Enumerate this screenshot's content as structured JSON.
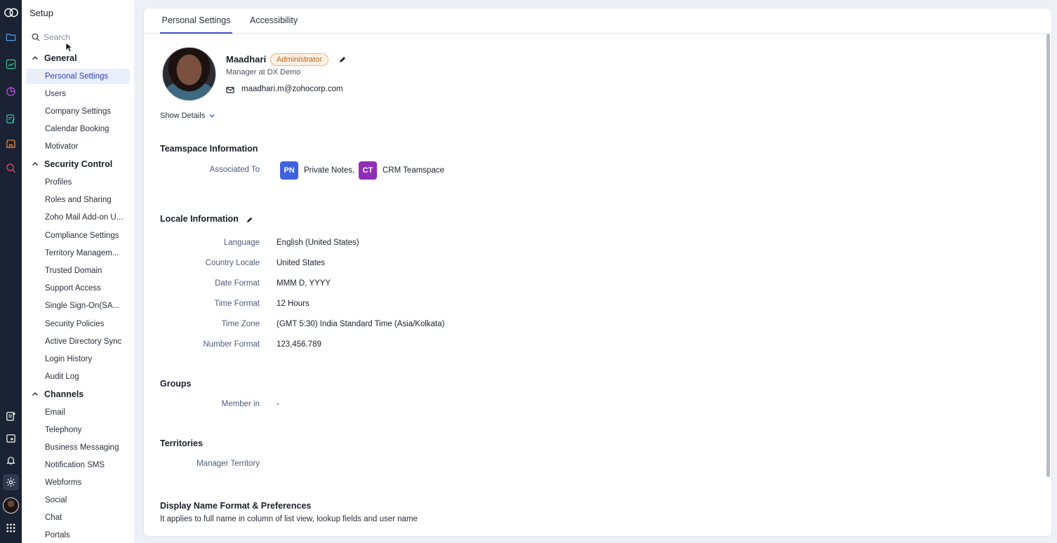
{
  "setup": {
    "title": "Setup",
    "search_placeholder": "Search",
    "groups": [
      {
        "label": "General",
        "items": [
          "Personal Settings",
          "Users",
          "Company Settings",
          "Calendar Booking",
          "Motivator"
        ]
      },
      {
        "label": "Security Control",
        "items": [
          "Profiles",
          "Roles and Sharing",
          "Zoho Mail Add-on U...",
          "Compliance Settings",
          "Territory Managem...",
          "Trusted Domain",
          "Support Access",
          "Single Sign-On(SA...",
          "Security Policies",
          "Active Directory Sync",
          "Login History",
          "Audit Log"
        ]
      },
      {
        "label": "Channels",
        "items": [
          "Email",
          "Telephony",
          "Business Messaging",
          "Notification SMS",
          "Webforms",
          "Social",
          "Chat",
          "Portals"
        ]
      }
    ],
    "active_item": "Personal Settings"
  },
  "tabs": [
    "Personal Settings",
    "Accessibility"
  ],
  "profile": {
    "name": "Maadhari",
    "badge": "Administrator",
    "role_line": "Manager at  DX Demo",
    "email": "maadhari.m@zohocorp.com",
    "show_details": "Show Details"
  },
  "teamspace": {
    "heading": "Teamspace Information",
    "label": "Associated To",
    "spaces": [
      {
        "abbr": "PN",
        "name": "Private Notes,",
        "color": "#3f63e0"
      },
      {
        "abbr": "CT",
        "name": "CRM Teamspace",
        "color": "#8e2fb5"
      }
    ]
  },
  "locale": {
    "heading": "Locale Information",
    "rows": [
      {
        "label": "Language",
        "value": "English (United States)"
      },
      {
        "label": "Country Locale",
        "value": "United States"
      },
      {
        "label": "Date Format",
        "value": "MMM D, YYYY"
      },
      {
        "label": "Time Format",
        "value": "12 Hours"
      },
      {
        "label": "Time Zone",
        "value": "(GMT 5:30) India Standard Time (Asia/Kolkata)"
      },
      {
        "label": "Number Format",
        "value": "123,456.789"
      }
    ]
  },
  "groups": {
    "heading": "Groups",
    "label": "Member in",
    "value": "-"
  },
  "territories": {
    "heading": "Territories",
    "label": "Manager Territory",
    "value": ""
  },
  "display_name": {
    "heading": "Display Name Format & Preferences",
    "note": "It applies to full name in column of list view, lookup fields and user name"
  },
  "colors": {
    "accent": "#3b4ec9",
    "rail": "#1a2233",
    "badge_text": "#c2611c"
  },
  "rail_icons": [
    "zoho-crm-logo-icon",
    "folder-icon",
    "chart-icon",
    "pie-chart-icon",
    "checklist-icon",
    "store-icon",
    "search-analytics-icon",
    "add-note-icon",
    "calendar-icon",
    "bell-icon",
    "gear-icon",
    "user-avatar",
    "apps-grid-icon"
  ]
}
